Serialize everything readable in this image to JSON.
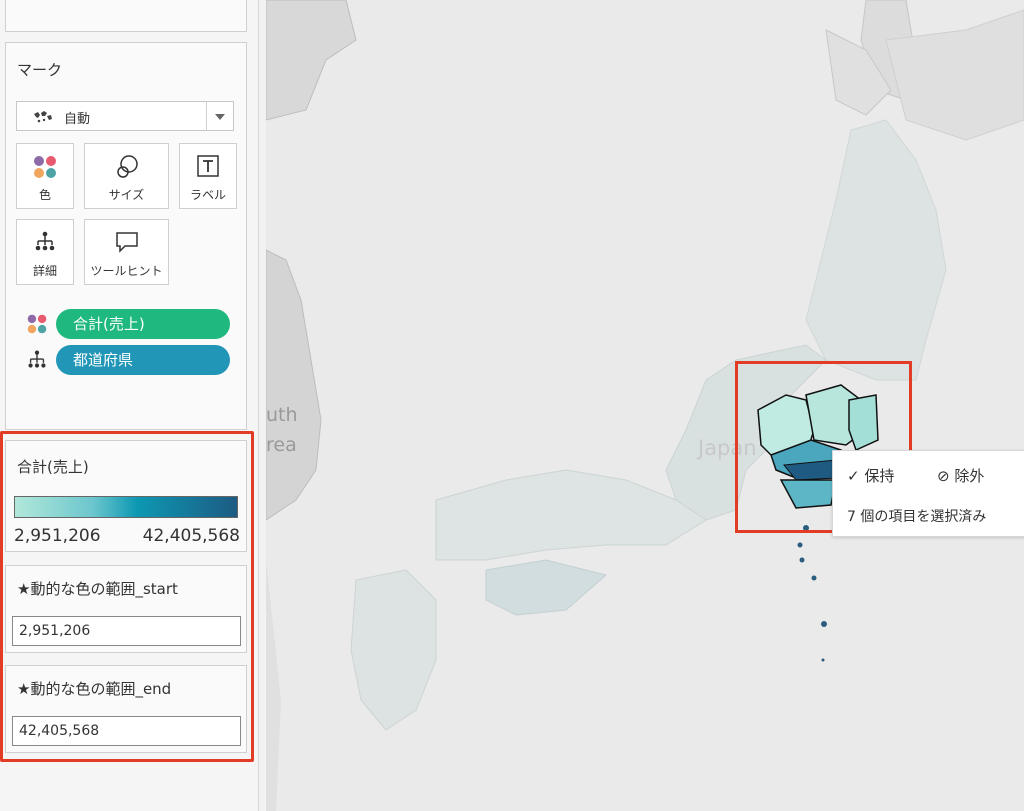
{
  "marks": {
    "title": "マーク",
    "mark_type": "自動",
    "buttons": {
      "color": "色",
      "size": "サイズ",
      "label": "ラベル",
      "detail": "詳細",
      "tooltip": "ツールヒント"
    },
    "pills": [
      {
        "label": "合計(売上)",
        "icon": "color-dots-icon",
        "color": "#1fb87e"
      },
      {
        "label": "都道府県",
        "icon": "hierarchy-icon",
        "color": "#2196b6"
      }
    ]
  },
  "legend": {
    "title": "合計(売上)",
    "min": "2,951,206",
    "max": "42,405,568",
    "colors": [
      "#b2e8da",
      "#0d98b2",
      "#1d5b83"
    ]
  },
  "params": {
    "start": {
      "title": "★動的な色の範囲_start",
      "value": "2,951,206"
    },
    "end": {
      "title": "★動的な色の範囲_end",
      "value": "42,405,568"
    }
  },
  "map": {
    "label_korea": "uth\nrea",
    "label_japan": "Japan"
  },
  "tooltip": {
    "keep": "保持",
    "exclude": "除外",
    "selection": "7 個の項目を選択済み"
  },
  "highlight_color": "#e23b26"
}
